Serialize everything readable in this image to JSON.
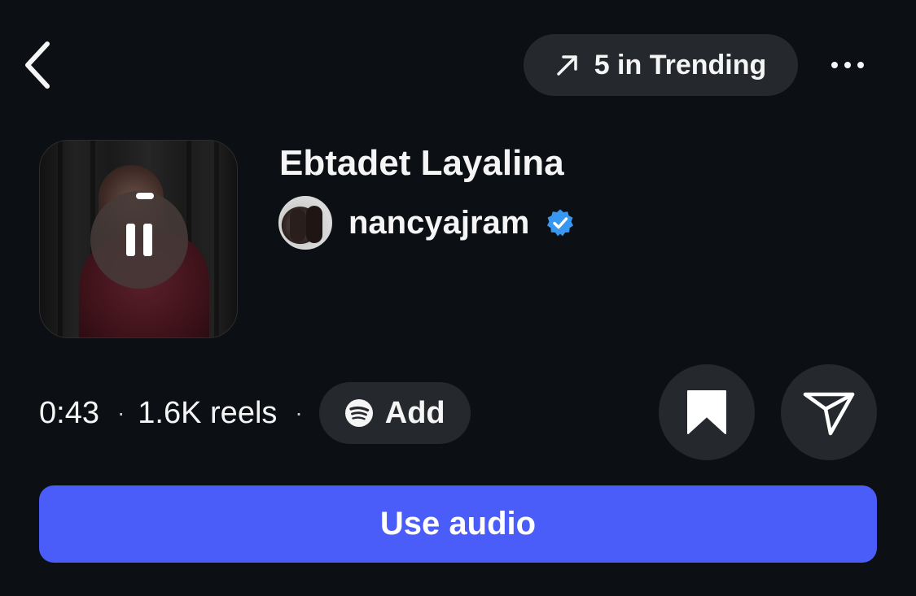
{
  "header": {
    "back_icon": "chevron-left-icon",
    "trending_icon": "arrow-up-right-icon",
    "trending_label": "5 in Trending",
    "more_icon": "more-horizontal-icon"
  },
  "audio": {
    "title": "Ebtadet Layalina",
    "artist": "nancyajram",
    "artist_verified": true,
    "playback_state": "playing",
    "duration": "0:43",
    "reels_count": "1.6K reels",
    "separator": "·",
    "spotify_label": "Add"
  },
  "actions": {
    "save_icon": "bookmark-icon",
    "share_icon": "send-icon",
    "use_audio_label": "Use audio"
  },
  "colors": {
    "background": "#0c1014",
    "pill": "#25292e",
    "primary": "#4a5df9",
    "verified": "#3897f0"
  }
}
